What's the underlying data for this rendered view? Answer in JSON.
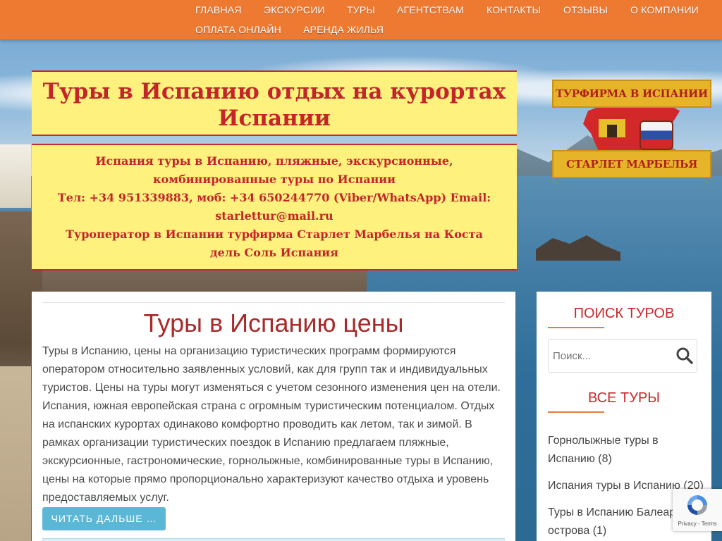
{
  "nav": {
    "row1": [
      "ГЛАВНАЯ",
      "ЭКСКУРСИИ",
      "ТУРЫ",
      "АГЕНТСТВАМ",
      "КОНТАКТЫ",
      "ОТЗЫВЫ",
      "О КОМПАНИИ"
    ],
    "row2": [
      "ОПЛАТА ОНЛАЙН",
      "АРЕНДА ЖИЛЬЯ"
    ]
  },
  "header": {
    "title": "Туры в Испанию отдых на курортах Испании",
    "desc_line1": "Испания туры в Испанию, пляжные, экскурсионные, комбинированные туры по Испании",
    "desc_line2": "Тел: +34 951339883, моб: +34 650244770 (Viber/WhatsApp) Email: starlettur@mail.ru",
    "desc_line3": "Туроператор в Испании турфирма Старлет Марбелья на Коста дель Соль Испания"
  },
  "logo": {
    "top_text": "ТУРФИРМА В ИСПАНИИ",
    "bottom_text": "СТАРЛЕТ МАРБЕЛЬЯ"
  },
  "post": {
    "title": "Туры в Испанию цены",
    "text": "Туры в Испанию, цены на организацию туристических программ формируются оператором относительно заявленных условий, как для групп так и индивидуальных туристов. Цены на туры могут изменяться с учетом сезонного изменения цен на отели. Испания, южная европейская страна с огромным туристическим потенциалом. Отдых на испанских курортах одинаково комфортно проводить как летом, так и зимой. В рамках организации туристических поездок в Испанию предлагаем пляжные, экскурсионные, гастрономические, горнолыжные, комбинированные туры в Испанию, цены на которые прямо пропорционально характеризуют качество отдыха и уровень предоставляемых услуг.",
    "read_more": "ЧИТАТЬ ДАЛЬШЕ …"
  },
  "sidebar": {
    "search_title": "ПОИСК ТУРОВ",
    "search_placeholder": "Поиск...",
    "tours_title": "ВСЕ ТУРЫ",
    "tours": [
      {
        "name": "Горнолыжные туры в Испанию",
        "count": "(8)"
      },
      {
        "name": "Испания туры в Испанию",
        "count": "(20)"
      },
      {
        "name": "Туры в Испанию Балеарские острова",
        "count": "(1)"
      }
    ]
  },
  "recaptcha": {
    "links": "Privacy - Terms"
  },
  "colors": {
    "nav_bg": "#ee7a32",
    "header_bg": "#fff17d",
    "header_text": "#c2262b",
    "accent_red": "#c8282b",
    "button_bg": "#5ab7d6"
  }
}
